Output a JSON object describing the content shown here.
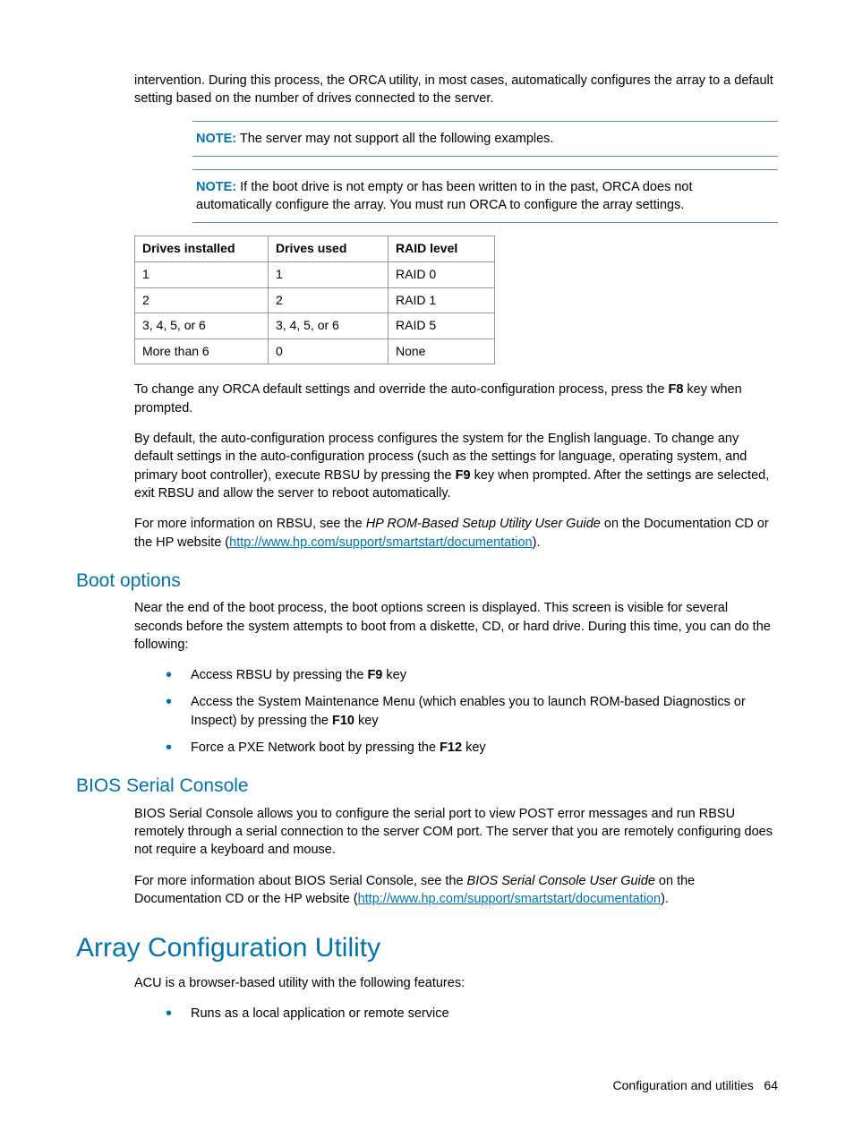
{
  "intro_para": "intervention. During this process, the ORCA utility, in most cases, automatically configures the array to a default setting based on the number of drives connected to the server.",
  "note1_label": "NOTE:",
  "note1_text": "  The server may not support all the following examples.",
  "note2_label": "NOTE:",
  "note2_text": "  If the boot drive is not empty or has been written to in the past, ORCA does not automatically configure the array. You must run ORCA to configure the array settings.",
  "table": {
    "headers": [
      "Drives installed",
      "Drives used",
      "RAID level"
    ],
    "rows": [
      [
        "1",
        "1",
        "RAID 0"
      ],
      [
        "2",
        "2",
        "RAID 1"
      ],
      [
        "3, 4, 5, or 6",
        "3, 4, 5, or 6",
        "RAID 5"
      ],
      [
        "More than 6",
        "0",
        "None"
      ]
    ]
  },
  "change_orca_1": "To change any ORCA default settings and override the auto-configuration process, press the ",
  "change_orca_key": "F8",
  "change_orca_2": " key when prompted.",
  "auto_config_1": "By default, the auto-configuration process configures the system for the English language. To change any default settings in the auto-configuration process (such as the settings for language, operating system, and primary boot controller), execute RBSU by pressing the ",
  "auto_config_key": "F9",
  "auto_config_2": " key when prompted. After the settings are selected, exit RBSU and allow the server to reboot automatically.",
  "rbsu_info_1": "For more information on RBSU, see the ",
  "rbsu_guide": "HP ROM-Based Setup Utility User Guide",
  "rbsu_info_2": " on the Documentation CD or the HP website (",
  "rbsu_link": "http://www.hp.com/support/smartstart/documentation",
  "rbsu_info_3": ").",
  "boot_options_heading": "Boot options",
  "boot_options_intro": "Near the end of the boot process, the boot options screen is displayed. This screen is visible for several seconds before the system attempts to boot from a diskette, CD, or hard drive. During this time, you can do the following:",
  "boot_li1_a": "Access RBSU by pressing the ",
  "boot_li1_key": "F9",
  "boot_li1_b": " key",
  "boot_li2_a": "Access the System Maintenance Menu (which enables you to launch ROM-based Diagnostics or Inspect) by pressing the ",
  "boot_li2_key": "F10",
  "boot_li2_b": " key",
  "boot_li3_a": "Force a PXE Network boot by pressing the ",
  "boot_li3_key": "F12",
  "boot_li3_b": " key",
  "bios_heading": "BIOS Serial Console",
  "bios_para1": "BIOS Serial Console allows you to configure the serial port to view POST error messages and run RBSU remotely through a serial connection to the server COM port. The server that you are remotely configuring does not require a keyboard and mouse.",
  "bios_para2_a": "For more information about BIOS Serial Console, see the ",
  "bios_guide": "BIOS Serial Console User Guide",
  "bios_para2_b": " on the Documentation CD or the HP website (",
  "bios_link": "http://www.hp.com/support/smartstart/documentation",
  "bios_para2_c": ").",
  "acu_heading": "Array Configuration Utility",
  "acu_intro": "ACU is a browser-based utility with the following features:",
  "acu_li1": "Runs as a local application or remote service",
  "footer_section": "Configuration and utilities",
  "footer_page": "64"
}
